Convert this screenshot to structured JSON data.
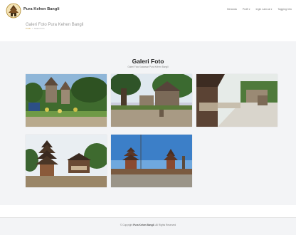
{
  "brand": {
    "name": "Pura Kehen Bangli",
    "logo_icon": "temple-emblem-icon"
  },
  "nav": {
    "items": [
      {
        "label": "Beranda",
        "has_dropdown": false
      },
      {
        "label": "Profil",
        "has_dropdown": true
      },
      {
        "label": "Ingin Lain-lai",
        "has_dropdown": true
      },
      {
        "label": "Tagging Info",
        "has_dropdown": false
      }
    ]
  },
  "breadcrumb": {
    "page_title": "Galeri Foto Pura Kehen Bangli",
    "home": "Profil",
    "separator": "/",
    "current": "Galeri Foto"
  },
  "gallery": {
    "title": "Galeri Foto",
    "subtitle": "Galeri Foto Kawasan Pura Kehen Bangli",
    "photos": [
      {
        "alt": "Temple courtyard with shrines and gardens"
      },
      {
        "alt": "Large banyan tree at temple entrance"
      },
      {
        "alt": "Temple pavilion walkway"
      },
      {
        "alt": "Multi-tiered meru shrine"
      },
      {
        "alt": "Temple meru towers under blue sky"
      }
    ]
  },
  "footer": {
    "copyright_prefix": "© Copyright",
    "site_name": "Pura Kehen Bangli",
    "rights": "All Rights Reserved"
  },
  "colors": {
    "accent": "#c9a24a",
    "section_bg": "#f3f4f6"
  }
}
